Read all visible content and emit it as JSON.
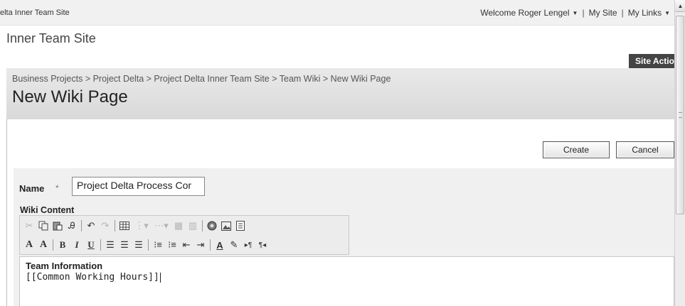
{
  "topbar": {
    "site_crumb": "elta Inner Team Site",
    "welcome": "Welcome Roger Lengel",
    "separator": "|",
    "my_site": "My Site",
    "my_links": "My Links"
  },
  "header": {
    "site_title": "Inner Team Site",
    "site_actions": "Site Actio"
  },
  "title_area": {
    "breadcrumb": "Business Projects > Project Delta > Project Delta Inner Team Site > Team Wiki > New Wiki Page",
    "page_title": "New Wiki Page"
  },
  "buttons": {
    "create": "Create",
    "cancel": "Cancel"
  },
  "form": {
    "name_label": "Name",
    "required_marker": "*",
    "name_value": "Project Delta Process Cor",
    "wiki_content_label": "Wiki Content"
  },
  "toolbar": {
    "row1": [
      "cut-icon",
      "copy-icon",
      "paste-icon",
      "spellcheck-icon",
      "undo-icon",
      "redo-icon",
      "insert-table-icon",
      "insert-row-icon",
      "insert-column-icon",
      "merge-cells-icon",
      "split-cells-icon",
      "insert-link-icon",
      "insert-image-icon",
      "insert-list-icon"
    ],
    "row2": [
      "font-icon",
      "font-size-icon",
      "bold-icon",
      "italic-icon",
      "underline-icon",
      "align-left-icon",
      "align-center-icon",
      "align-right-icon",
      "numbered-list-icon",
      "bulleted-list-icon",
      "decrease-indent-icon",
      "increase-indent-icon",
      "text-color-icon",
      "highlight-color-icon",
      "ltr-icon",
      "rtl-icon"
    ]
  },
  "editor": {
    "heading": "Team Information",
    "line": "[[Common Working Hours]]"
  },
  "colors": {
    "site_actions_bg": "#444444",
    "title_area_bg": "#dedede",
    "form_bg": "#f0f0f0"
  }
}
